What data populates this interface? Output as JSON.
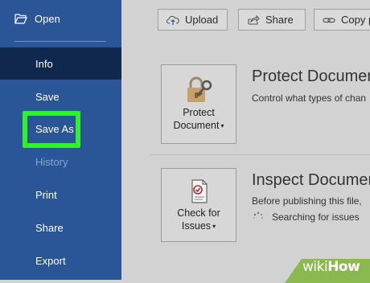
{
  "sidebar": {
    "open_label": "Open",
    "items": [
      {
        "label": "Info",
        "state": "active"
      },
      {
        "label": "Save",
        "state": "normal"
      },
      {
        "label": "Save As",
        "state": "highlighted"
      },
      {
        "label": "History",
        "state": "disabled"
      },
      {
        "label": "Print",
        "state": "normal"
      },
      {
        "label": "Share",
        "state": "normal"
      },
      {
        "label": "Export",
        "state": "normal"
      }
    ]
  },
  "toolbar": {
    "upload_label": "Upload",
    "share_label": "Share",
    "copy_path_label": "Copy p"
  },
  "protect": {
    "button_line1": "Protect",
    "button_line2": "Document",
    "title": "Protect Documen",
    "description": "Control what types of chan"
  },
  "inspect": {
    "button_line1": "Check for",
    "button_line2": "Issues",
    "title": "Inspect Documen",
    "description": "Before publishing this file,",
    "status": "Searching for issues"
  },
  "watermark": {
    "part1": "wiki",
    "part2": "How"
  },
  "colors": {
    "sidebar_bg": "#2a5597",
    "sidebar_active": "#10284e",
    "highlight_box": "#2ff22a",
    "main_bg": "#d2d2d2",
    "watermark_green": "#89b94f"
  }
}
